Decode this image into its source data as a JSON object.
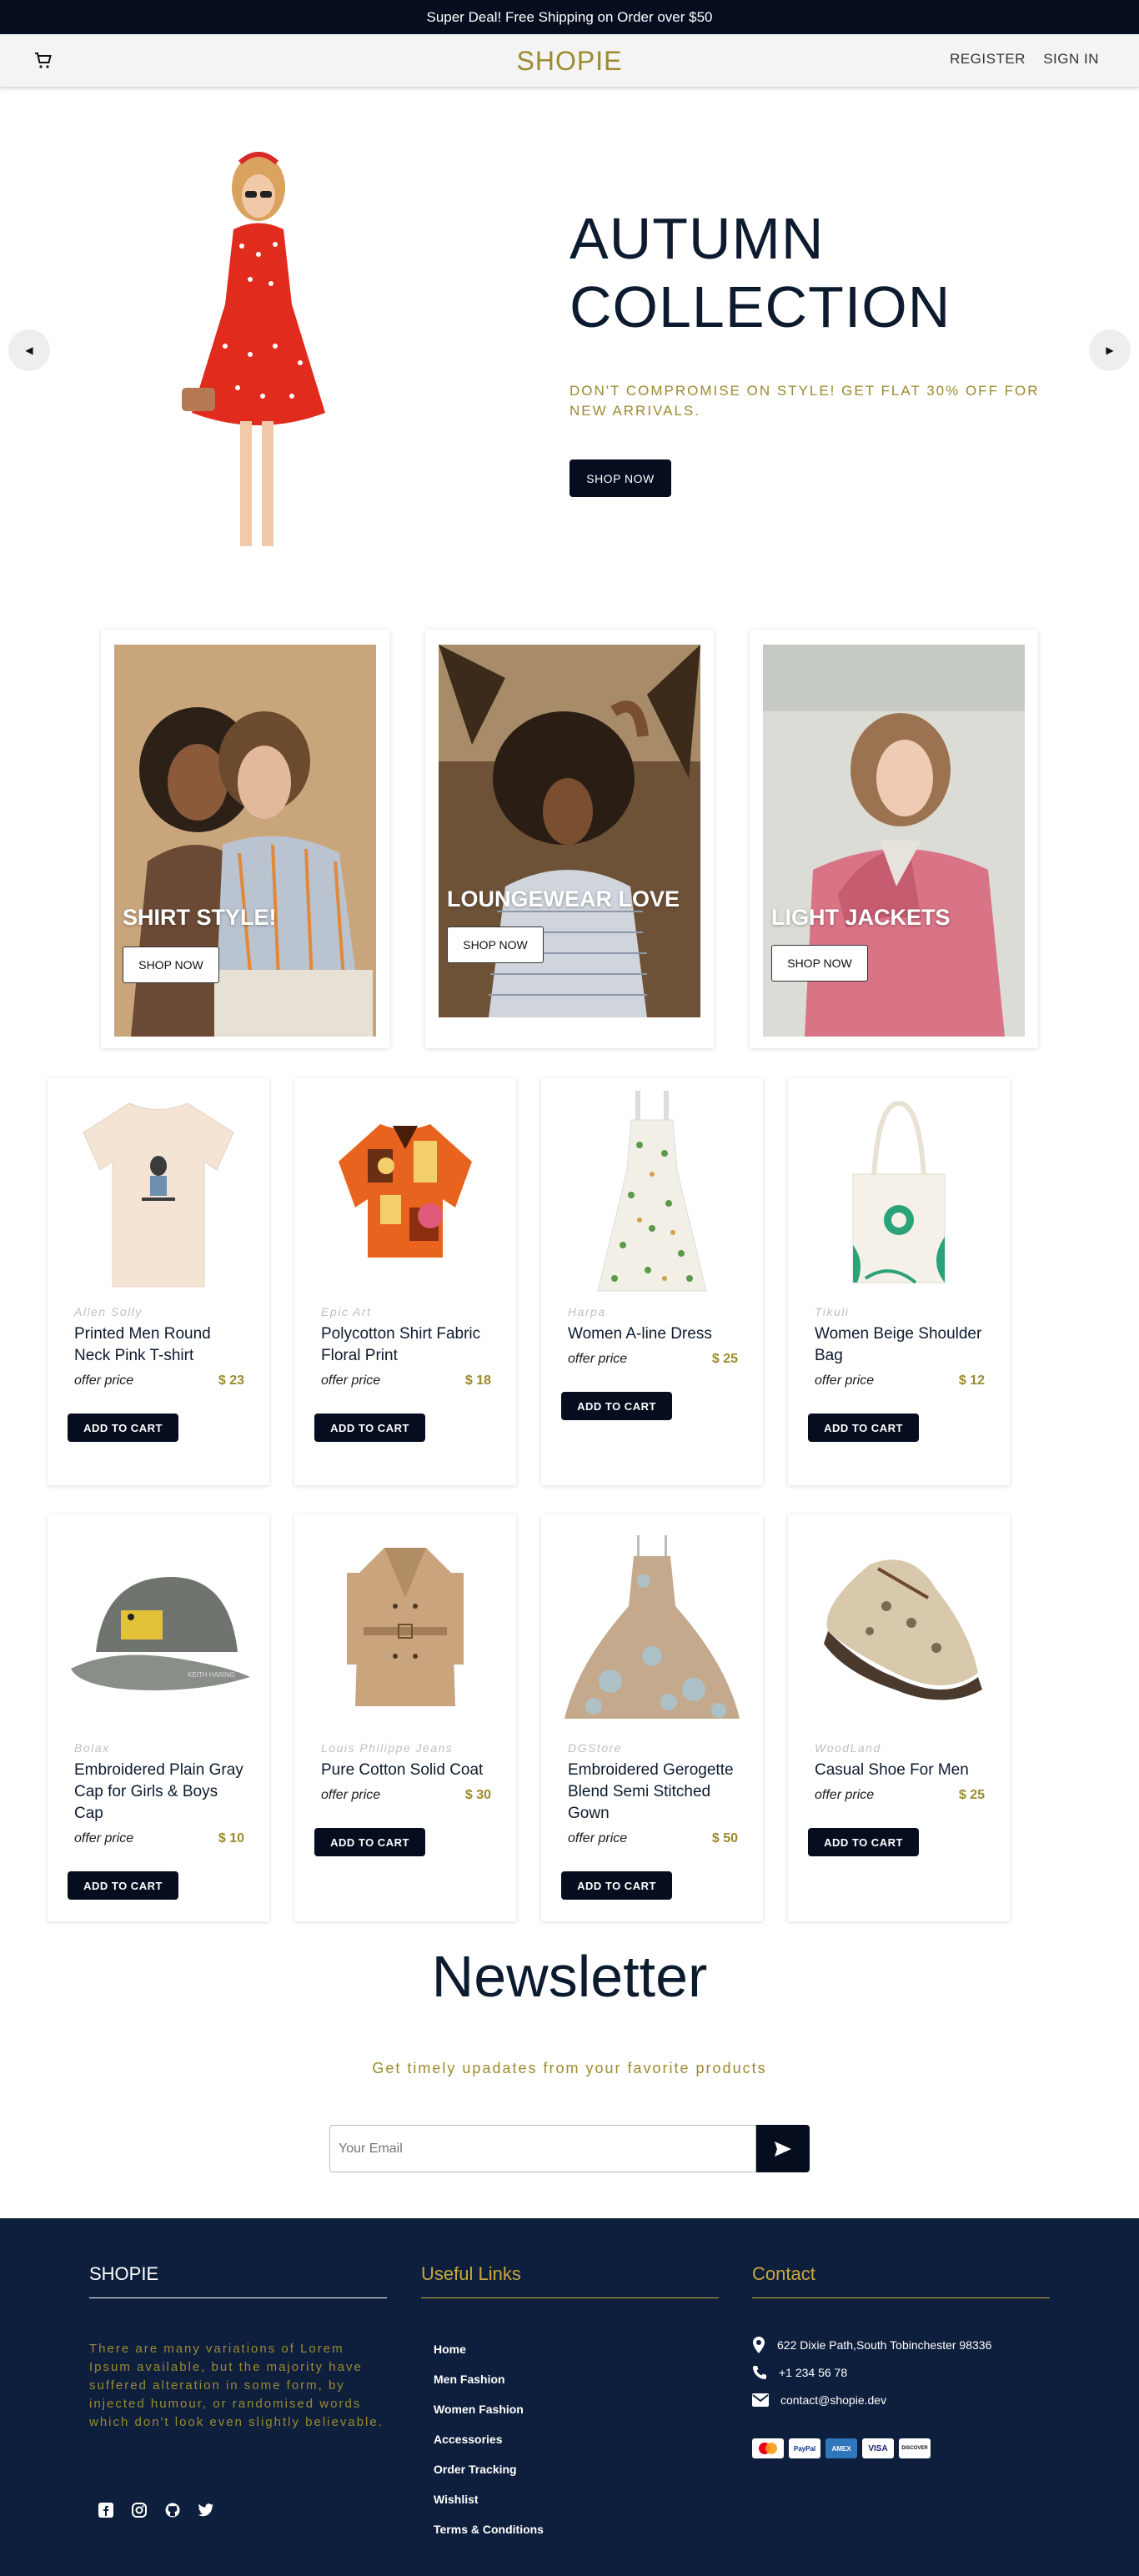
{
  "topbar": {
    "text": "Super Deal! Free Shipping on Order over $50"
  },
  "navbar": {
    "logo": "SHOPIE",
    "register": "REGISTER",
    "signin": "SIGN IN"
  },
  "hero": {
    "title_line1": "AUTUMN",
    "title_line2": "COLLECTION",
    "subtitle": "DON'T COMPROMISE ON STYLE! GET FLAT 30% OFF FOR NEW ARRIVALS.",
    "button": "SHOP NOW"
  },
  "categories": [
    {
      "title": "SHIRT STYLE!",
      "button": "SHOP NOW"
    },
    {
      "title": "LOUNGEWEAR LOVE",
      "button": "SHOP NOW"
    },
    {
      "title": "LIGHT JACKETS",
      "button": "SHOP NOW"
    }
  ],
  "products": [
    {
      "brand": "Allen Solly",
      "name": "Printed Men Round Neck Pink T-shirt",
      "offer": "offer price",
      "price": "$ 23",
      "button": "ADD TO CART"
    },
    {
      "brand": "Epic Art",
      "name": "Polycotton Shirt Fabric Floral Print",
      "offer": "offer price",
      "price": "$ 18",
      "button": "ADD TO CART"
    },
    {
      "brand": "Harpa",
      "name": "Women A-line Dress",
      "offer": "offer price",
      "price": "$ 25",
      "button": "ADD TO CART"
    },
    {
      "brand": "Tikuli",
      "name": "Women Beige Shoulder Bag",
      "offer": "offer price",
      "price": "$ 12",
      "button": "ADD TO CART"
    },
    {
      "brand": "Bolax",
      "name": "Embroidered Plain Gray Cap for Girls & Boys Cap",
      "offer": "offer price",
      "price": "$ 10",
      "button": "ADD TO CART"
    },
    {
      "brand": "Louis Philippe Jeans",
      "name": "Pure Cotton Solid Coat",
      "offer": "offer price",
      "price": "$ 30",
      "button": "ADD TO CART"
    },
    {
      "brand": "DGStore",
      "name": "Embroidered Gerogette Blend Semi Stitched Gown",
      "offer": "offer price",
      "price": "$ 50",
      "button": "ADD TO CART"
    },
    {
      "brand": "WoodLand",
      "name": "Casual Shoe For Men",
      "offer": "offer price",
      "price": "$ 25",
      "button": "ADD TO CART"
    }
  ],
  "newsletter": {
    "title": "Newsletter",
    "subtitle": "Get timely upadates from your favorite products",
    "placeholder": "Your Email"
  },
  "footer": {
    "brand": "SHOPIE",
    "about": "There are many variations of Lorem Ipsum available, but the majority have suffered alteration in some form, by injected humour, or randomised words which don't look even slightly believable.",
    "links_title": "Useful Links",
    "links": [
      "Home",
      "Men Fashion",
      "Women Fashion",
      "Accessories",
      "Order Tracking",
      "Wishlist",
      "Terms & Conditions"
    ],
    "contact_title": "Contact",
    "address": "622 Dixie Path,South Tobinchester 98336",
    "phone": "+1 234 56 78",
    "email": "contact@shopie.dev",
    "payments": [
      "MasterCard",
      "PayPal",
      "AmEx",
      "VISA",
      "DISCOVER"
    ]
  },
  "colors": {
    "navy": "#050d1f",
    "gold": "#9b8a2e",
    "footer": "#0e1f3d"
  }
}
